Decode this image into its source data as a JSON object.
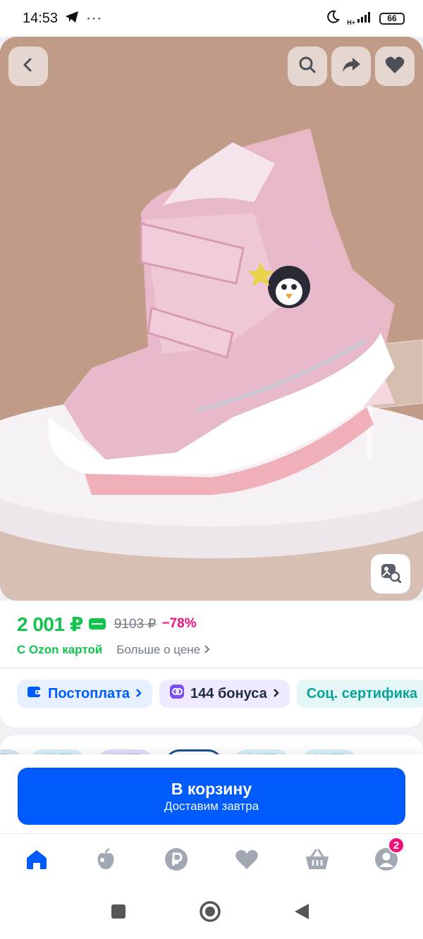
{
  "status_bar": {
    "time": "14:53",
    "telegram_icon": "paper-plane-icon",
    "more": "···",
    "network": "H+",
    "battery": "66"
  },
  "hero": {
    "back_icon": "chevron-left-icon",
    "search_icon": "search-icon",
    "share_icon": "share-arrow-icon",
    "favorite_icon": "heart-icon",
    "visual_search_icon": "image-search-icon"
  },
  "price": {
    "current": "2 001 ₽",
    "old": "9103 ₽",
    "discount": "−78%",
    "ozon_card": "С Ozon картой",
    "more_about_price": "Больше о цене"
  },
  "chips": [
    {
      "label": "Постоплата",
      "icon": "wallet-icon"
    },
    {
      "label": "144 бонуса",
      "icon": "bonus-icon"
    },
    {
      "label": "Соц. сертифика",
      "icon": ""
    }
  ],
  "brand_logos": [
    "SHUZZI",
    "SHUZZI",
    "SHUZZI",
    "SHUZZI",
    "SHUZZI",
    "SHUZZI"
  ],
  "cart": {
    "title": "В корзину",
    "subtitle": "Доставим завтра"
  },
  "bottom_nav": {
    "items": [
      {
        "name": "home",
        "icon": "home-icon",
        "active": true
      },
      {
        "name": "fresh",
        "icon": "apple-icon"
      },
      {
        "name": "finance",
        "icon": "ruble-icon"
      },
      {
        "name": "favorites",
        "icon": "heart-icon"
      },
      {
        "name": "cart",
        "icon": "basket-icon"
      },
      {
        "name": "profile",
        "icon": "profile-icon"
      }
    ],
    "profile_badge": "2"
  },
  "colors": {
    "accent": "#005bff",
    "price_green": "#10c44c",
    "discount_pink": "#f1117e"
  }
}
